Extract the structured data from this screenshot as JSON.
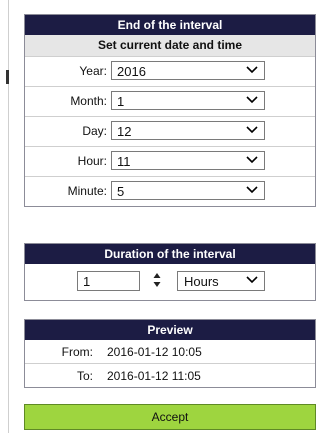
{
  "end_interval": {
    "title": "End of the interval",
    "set_current": "Set current date and time",
    "fields": [
      {
        "label": "Year:",
        "value": "2016"
      },
      {
        "label": "Month:",
        "value": "1"
      },
      {
        "label": "Day:",
        "value": "12"
      },
      {
        "label": "Hour:",
        "value": "11"
      },
      {
        "label": "Minute:",
        "value": "5"
      }
    ]
  },
  "duration": {
    "title": "Duration of the interval",
    "value": "1",
    "unit": "Hours"
  },
  "preview": {
    "title": "Preview",
    "from_label": "From:",
    "from_value": "2016-01-12 10:05",
    "to_label": "To:",
    "to_value": "2016-01-12 11:05"
  },
  "actions": {
    "accept_label": "Accept"
  }
}
